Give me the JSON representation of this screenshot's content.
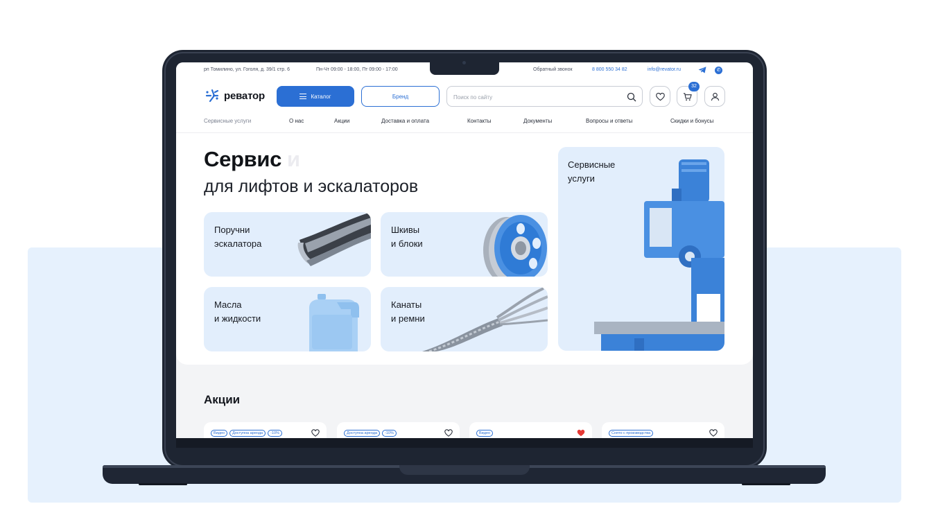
{
  "topbar": {
    "address": "рп Томилино, ул. Гоголя, д. 39/1 стр. 6",
    "hours": "Пн-Чт 09:00 - 18:00, Пт 09:00 - 17:00",
    "callback": "Обратный звонок",
    "phone": "8 800 550 34 82",
    "email": "info@revator.ru"
  },
  "header": {
    "logo_text": "реватор",
    "catalog_label": "Каталог",
    "brand_label": "Бренд",
    "search_placeholder": "Поиск по сайту",
    "cart_count": "32"
  },
  "nav": {
    "items": [
      "Сервисные услуги",
      "О нас",
      "Акции",
      "Доставка и оплата",
      "Контакты",
      "Документы",
      "Вопросы и ответы",
      "Скидки и бонусы"
    ]
  },
  "hero": {
    "title": "Сервис",
    "title_ghost": "и",
    "subtitle": "для лифтов и эскалаторов"
  },
  "categories": [
    {
      "line1": "Поручни",
      "line2": "эскалатора"
    },
    {
      "line1": "Шкивы",
      "line2": "и блоки"
    },
    {
      "line1": "Масла",
      "line2": "и жидкости"
    },
    {
      "line1": "Канаты",
      "line2": "и ремни"
    }
  ],
  "service_card": {
    "line1": "Сервисные",
    "line2": "услуги"
  },
  "promotions": {
    "title": "Акции",
    "cards": [
      {
        "tags": [
          "Видео",
          "Доступна аренда",
          "-10%"
        ],
        "favorite": false
      },
      {
        "tags": [
          "Доступна аренда",
          "-10%"
        ],
        "favorite": false
      },
      {
        "tags": [
          "Видео"
        ],
        "favorite": true
      },
      {
        "tags": [
          "Снято с производства"
        ],
        "favorite": false
      }
    ]
  },
  "colors": {
    "accent": "#2b6fd4",
    "card_bg": "#e2eefc",
    "favorite": "#e53935",
    "backdrop": "#e6f1fd"
  }
}
